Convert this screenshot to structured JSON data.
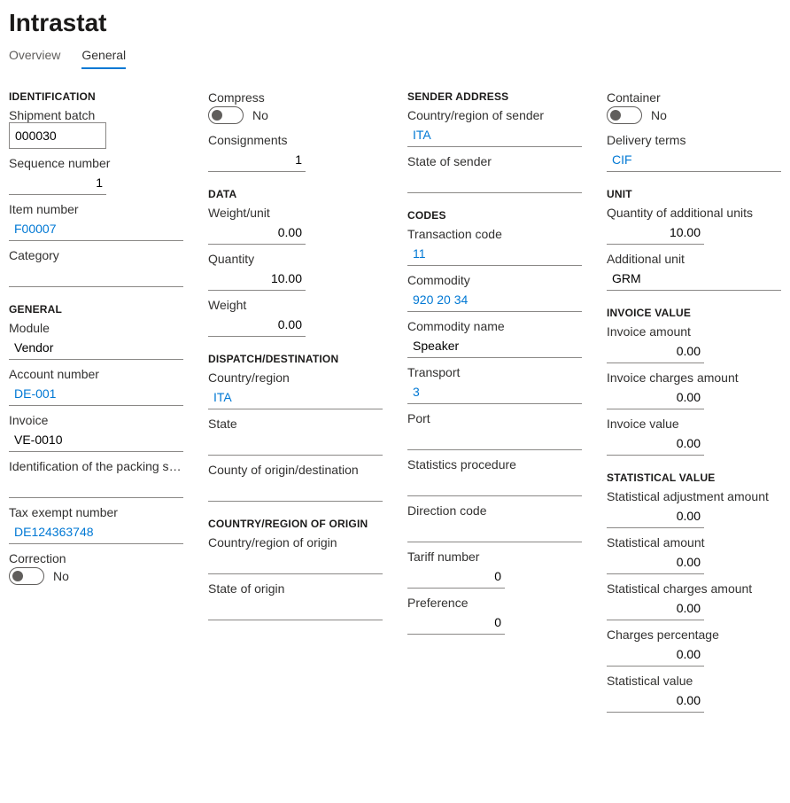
{
  "page": {
    "title": "Intrastat"
  },
  "tabs": {
    "overview": "Overview",
    "general": "General"
  },
  "sections": {
    "identification": "IDENTIFICATION",
    "general": "GENERAL",
    "data": "DATA",
    "dispatch": "DISPATCH/DESTINATION",
    "coo": "COUNTRY/REGION OF ORIGIN",
    "sender": "SENDER ADDRESS",
    "codes": "CODES",
    "unit": "UNIT",
    "invoice_value": "INVOICE VALUE",
    "statistical": "STATISTICAL VALUE"
  },
  "labels": {
    "shipment_batch": "Shipment batch",
    "sequence_number": "Sequence number",
    "item_number": "Item number",
    "category": "Category",
    "module": "Module",
    "account_number": "Account number",
    "invoice": "Invoice",
    "packing_slip": "Identification of the packing slip ...",
    "tax_exempt": "Tax exempt number",
    "correction": "Correction",
    "compress": "Compress",
    "consignments": "Consignments",
    "weight_unit": "Weight/unit",
    "quantity": "Quantity",
    "weight": "Weight",
    "country_region": "Country/region",
    "state": "State",
    "county_origin_dest": "County of origin/destination",
    "country_region_origin": "Country/region of origin",
    "state_origin": "State of origin",
    "country_region_sender": "Country/region of sender",
    "state_sender": "State of sender",
    "transaction_code": "Transaction code",
    "commodity": "Commodity",
    "commodity_name": "Commodity name",
    "transport": "Transport",
    "port": "Port",
    "stat_procedure": "Statistics procedure",
    "direction_code": "Direction code",
    "tariff_number": "Tariff number",
    "preference": "Preference",
    "container": "Container",
    "delivery_terms": "Delivery terms",
    "qty_additional_units": "Quantity of additional units",
    "additional_unit": "Additional unit",
    "invoice_amount": "Invoice amount",
    "invoice_charges": "Invoice charges amount",
    "invoice_value": "Invoice value",
    "stat_adjustment": "Statistical adjustment amount",
    "stat_amount": "Statistical amount",
    "stat_charges": "Statistical charges amount",
    "charges_pct": "Charges percentage",
    "stat_value": "Statistical value"
  },
  "values": {
    "shipment_batch": "000030",
    "sequence_number": "1",
    "item_number": "F00007",
    "category": "",
    "module": "Vendor",
    "account_number": "DE-001",
    "invoice": "VE-0010",
    "packing_slip": "",
    "tax_exempt": "DE124363748",
    "correction": "No",
    "compress": "No",
    "consignments": "1",
    "weight_unit": "0.00",
    "quantity": "10.00",
    "weight": "0.00",
    "country_region": "ITA",
    "state": "",
    "county_origin_dest": "",
    "country_region_origin": "",
    "state_origin": "",
    "country_region_sender": "ITA",
    "state_sender": "",
    "transaction_code": "11",
    "commodity": "920 20 34",
    "commodity_name": "Speaker",
    "transport": "3",
    "port": "",
    "stat_procedure": "",
    "direction_code": "",
    "tariff_number": "0",
    "preference": "0",
    "container": "No",
    "delivery_terms": "CIF",
    "qty_additional_units": "10.00",
    "additional_unit": "GRM",
    "invoice_amount": "0.00",
    "invoice_charges": "0.00",
    "invoice_value": "0.00",
    "stat_adjustment": "0.00",
    "stat_amount": "0.00",
    "stat_charges": "0.00",
    "charges_pct": "0.00",
    "stat_value": "0.00"
  }
}
